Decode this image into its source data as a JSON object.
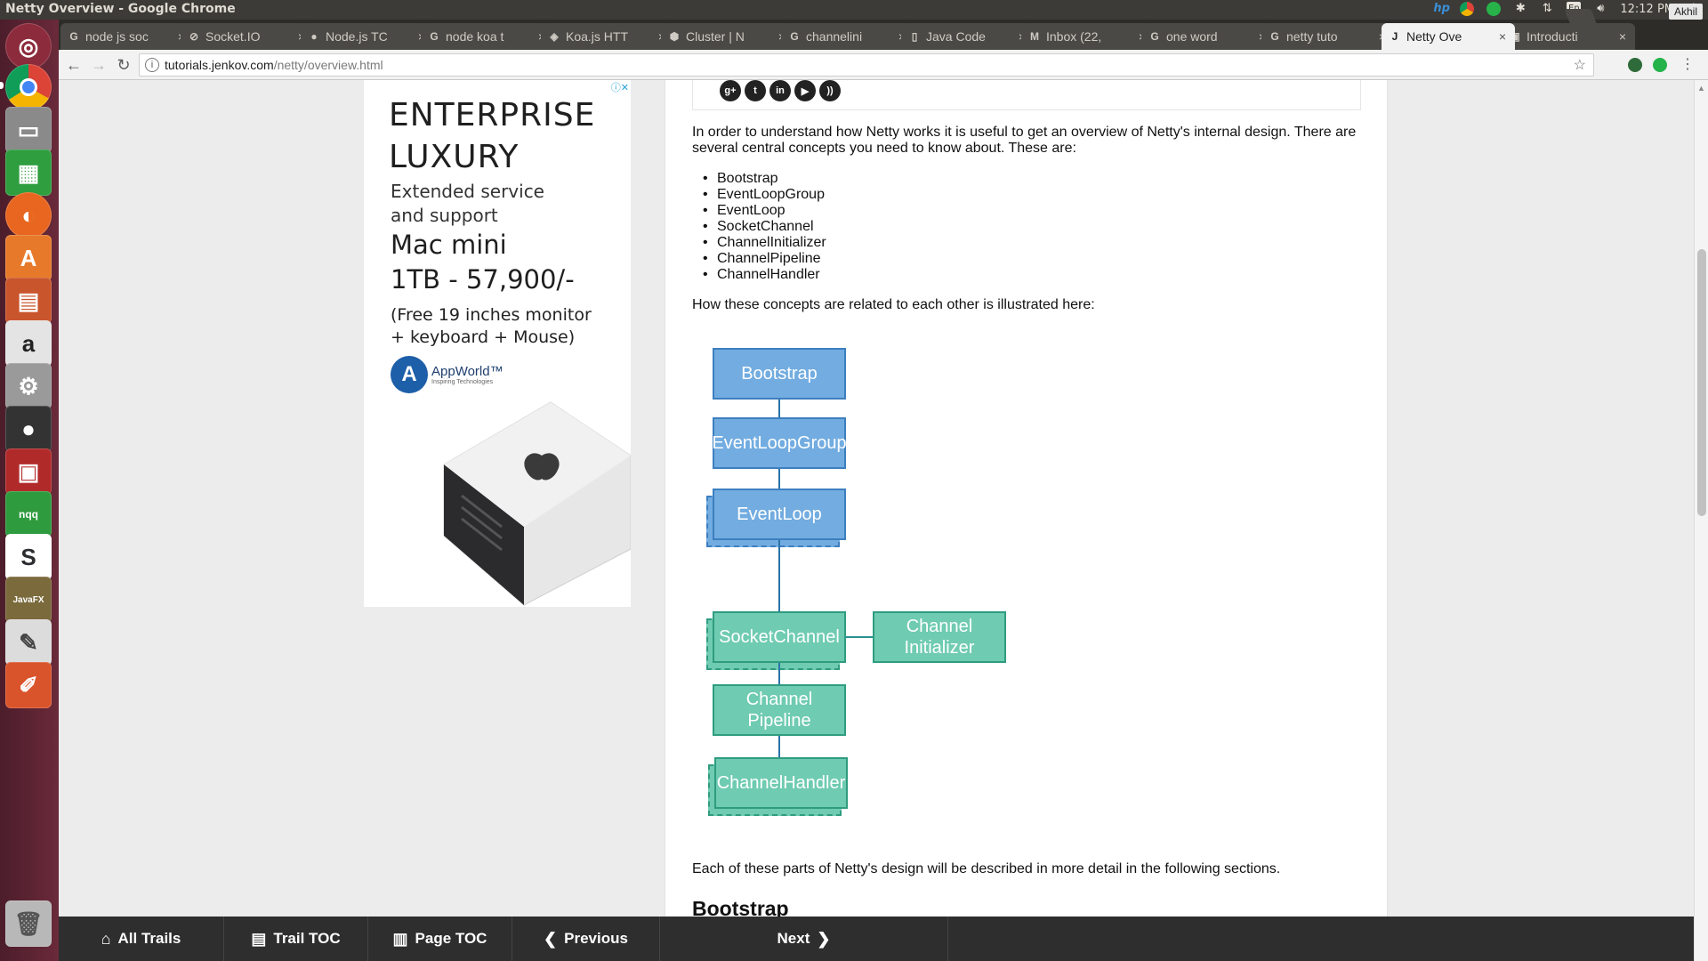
{
  "window": {
    "title": "Netty Overview - Google Chrome"
  },
  "tray": {
    "keyboard": "En",
    "time": "12:12 PM",
    "user": "Akhil"
  },
  "tabs": [
    {
      "label": "node js soc",
      "favicon": "G"
    },
    {
      "label": "Socket.IO",
      "favicon": "⊘"
    },
    {
      "label": "Node.js TC",
      "favicon": "●"
    },
    {
      "label": "node koa t",
      "favicon": "G"
    },
    {
      "label": "Koa.js HTT",
      "favicon": "◈"
    },
    {
      "label": "Cluster | N",
      "favicon": "⬢"
    },
    {
      "label": "channelini",
      "favicon": "G"
    },
    {
      "label": "Java Code",
      "favicon": "▯"
    },
    {
      "label": "Inbox (22,",
      "favicon": "M"
    },
    {
      "label": "one word",
      "favicon": "G"
    },
    {
      "label": "netty tuto",
      "favicon": "G"
    },
    {
      "label": "Netty Ove",
      "favicon": "J",
      "active": true
    },
    {
      "label": "Introducti",
      "favicon": "▣"
    }
  ],
  "address": {
    "host": "tutorials.jenkov.com",
    "path": "/netty/overview.html"
  },
  "ad": {
    "headline_1": "ENTERPRISE",
    "headline_2": "LUXURY",
    "sub_1": "Extended service",
    "sub_2": "and support",
    "product_1": "Mac mini",
    "product_2": "1TB - 57,900/-",
    "offer_1": "(Free 19 inches monitor",
    "offer_2": "+ keyboard + Mouse)",
    "brand": "AppWorld™",
    "brand_tag": "Inspiring Technologies"
  },
  "social": [
    "g+",
    "t",
    "in",
    "▶",
    "rss"
  ],
  "article": {
    "intro": "In order to understand how Netty works it is useful to get an overview of Netty's internal design. There are several central concepts you need to know about. These are:",
    "concepts": [
      "Bootstrap",
      "EventLoopGroup",
      "EventLoop",
      "SocketChannel",
      "ChannelInitializer",
      "ChannelPipeline",
      "ChannelHandler"
    ],
    "relation_text": "How these concepts are related to each other is illustrated here:",
    "diagram": {
      "bootstrap": "Bootstrap",
      "event_loop_group": "EventLoopGroup",
      "event_loop": "EventLoop",
      "socket_channel": "SocketChannel",
      "channel_initializer": "Channel Initializer",
      "channel_pipeline": "Channel Pipeline",
      "channel_handler": "ChannelHandler"
    },
    "outro": "Each of these parts of Netty's design will be described in more detail in the following sections.",
    "next_heading": "Bootstrap"
  },
  "bottom_nav": {
    "all_trails": "All Trails",
    "trail_toc": "Trail TOC",
    "page_toc": "Page TOC",
    "previous": "Previous",
    "next": "Next"
  },
  "colors": {
    "blue_box": "#72ace0",
    "green_box": "#6fcbb1",
    "launcher": "#5a2333",
    "nav_bar": "#2e2e2e"
  }
}
